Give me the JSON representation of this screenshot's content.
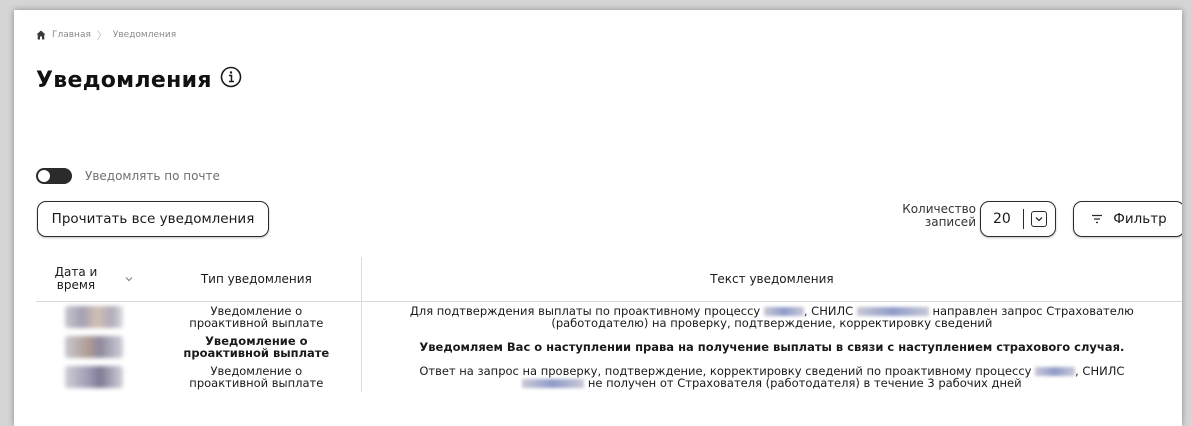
{
  "breadcrumb": {
    "home": "Главная",
    "current": "Уведомления"
  },
  "page": {
    "title": "Уведомления"
  },
  "toggle": {
    "label": "Уведомлять по почте",
    "enabled": false
  },
  "toolbar": {
    "read_all_label": "Прочитать все уведомления",
    "count_label_line1": "Количество",
    "count_label_line2": "записей",
    "count_value": "20",
    "filter_label": "Фильтр"
  },
  "table": {
    "headers": {
      "date_line1": "Дата и",
      "date_line2": "время",
      "type": "Тип уведомления",
      "text": "Текст уведомления"
    },
    "rows": [
      {
        "type_line1": "Уведомление о",
        "type_line2": "проактивной выплате",
        "text_part1": "Для подтверждения выплаты по проактивному процессу",
        "text_part2": ", СНИЛС",
        "text_part3": "направлен запрос Страхователю",
        "text_line2": "(работодателю) на проверку, подтверждение, корректировку сведений",
        "bold": false
      },
      {
        "type_line1": "Уведомление о",
        "type_line2": "проактивной выплате",
        "text": "Уведомляем Вас о наступлении права на получение выплаты в связи с наступлением страхового случая.",
        "bold": true
      },
      {
        "type_line1": "Уведомление о",
        "type_line2": "проактивной выплате",
        "text_part1": "Ответ на запрос на проверку, подтверждение, корректировку сведений по проактивному процессу",
        "text_part2": ", СНИЛС",
        "text_line2": "не получен от Страхователя (работодателя) в течение 3 рабочих дней",
        "bold": false
      }
    ]
  },
  "colors": {
    "border": "#2b2b2b",
    "muted_text": "#8a8a8a",
    "toggle_off": "#2b2b2b"
  }
}
